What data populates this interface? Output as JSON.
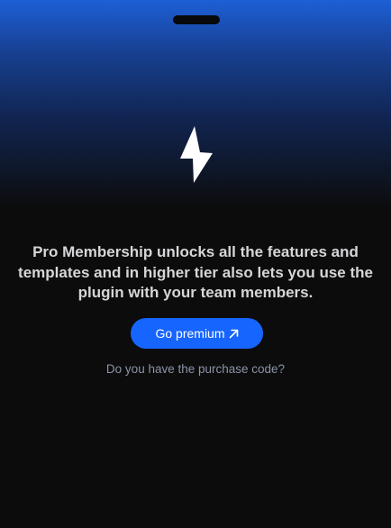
{
  "upgrade_panel": {
    "message": "Pro Membership unlocks all the features and templates and in higher tier also lets you use the plugin with your team members.",
    "premium_button_label": "Go premium",
    "purchase_code_link": "Do you have the purchase code?",
    "icons": {
      "hero": "lightning-bolt-icon",
      "button": "arrow-up-right-icon"
    },
    "colors": {
      "accent": "#1665ff",
      "gradient_top": "#1d5fd6",
      "background": "#0c0c0d",
      "text": "#d6d6d8",
      "muted_text": "#8b93a6"
    }
  }
}
